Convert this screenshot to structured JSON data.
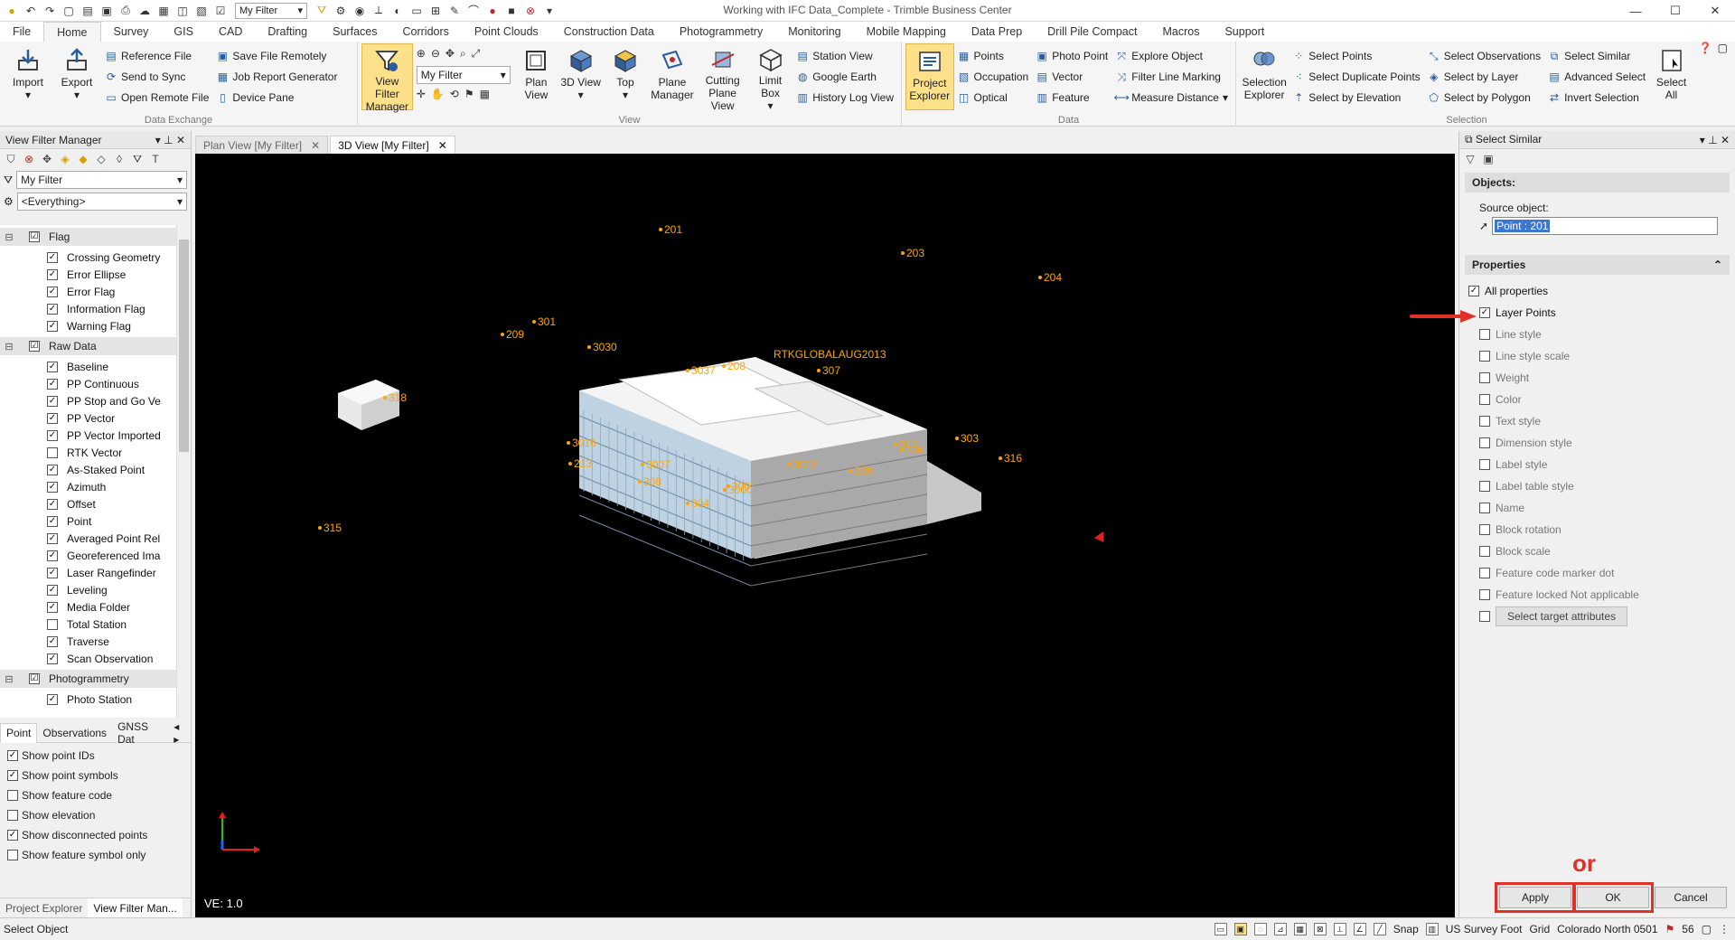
{
  "window": {
    "title": "Working with IFC Data_Complete - Trimble Business Center",
    "filter_value": "My Filter"
  },
  "ribbon_tabs": [
    "File",
    "Home",
    "Survey",
    "GIS",
    "CAD",
    "Drafting",
    "Surfaces",
    "Corridors",
    "Point Clouds",
    "Construction Data",
    "Photogrammetry",
    "Monitoring",
    "Mobile Mapping",
    "Data Prep",
    "Drill Pile Compact",
    "Macros",
    "Support"
  ],
  "ribbon": {
    "data_exchange": {
      "caption": "Data Exchange",
      "import": "Import",
      "export": "Export",
      "reference_file": "Reference File",
      "send_to_sync": "Send to Sync",
      "open_remote_file": "Open Remote File",
      "save_file_remotely": "Save File Remotely",
      "job_report_generator": "Job Report Generator",
      "device_pane": "Device Pane"
    },
    "view": {
      "caption": "View",
      "view_filter_manager": "View Filter Manager",
      "filter_select": "My Filter",
      "plan_view": "Plan View",
      "view_3d": "3D View",
      "top": "Top",
      "plane_manager": "Plane Manager",
      "cutting_plane_view": "Cutting Plane View",
      "limit_box": "Limit Box",
      "station_view": "Station View",
      "google_earth": "Google Earth",
      "history_log_view": "History Log View"
    },
    "data": {
      "caption": "Data",
      "project_explorer": "Project Explorer",
      "points": "Points",
      "occupation": "Occupation",
      "optical": "Optical",
      "photo_point": "Photo Point",
      "vector": "Vector",
      "feature": "Feature",
      "explore_object": "Explore Object",
      "filter_line_marking": "Filter Line Marking",
      "measure_distance": "Measure Distance"
    },
    "selection": {
      "caption": "Selection",
      "selection_explorer": "Selection Explorer",
      "select_points": "Select Points",
      "select_duplicate_points": "Select Duplicate Points",
      "select_by_elevation": "Select by Elevation",
      "select_observations": "Select Observations",
      "select_by_layer": "Select by Layer",
      "select_by_polygon": "Select by Polygon",
      "select_similar": "Select Similar",
      "advanced_select": "Advanced Select",
      "invert_selection": "Invert Selection",
      "select_all": "Select All"
    }
  },
  "left_panel": {
    "title": "View Filter Manager",
    "filter": "My Filter",
    "scope": "<Everything>",
    "groups": [
      {
        "name": "Flag",
        "items": [
          {
            "label": "Crossing Geometry",
            "checked": true
          },
          {
            "label": "Error Ellipse",
            "checked": true
          },
          {
            "label": "Error Flag",
            "checked": true
          },
          {
            "label": "Information Flag",
            "checked": true
          },
          {
            "label": "Warning Flag",
            "checked": true
          }
        ]
      },
      {
        "name": "Raw Data",
        "items": [
          {
            "label": "Baseline",
            "checked": true
          },
          {
            "label": "PP Continuous",
            "checked": true
          },
          {
            "label": "PP Stop and Go Ve",
            "checked": true
          },
          {
            "label": "PP Vector",
            "checked": true
          },
          {
            "label": "PP Vector Imported",
            "checked": true
          },
          {
            "label": "RTK Vector",
            "checked": false
          },
          {
            "label": "As-Staked Point",
            "checked": true
          },
          {
            "label": "Azimuth",
            "checked": true
          },
          {
            "label": "Offset",
            "checked": true
          },
          {
            "label": "Point",
            "checked": true
          },
          {
            "label": "Averaged Point Rel",
            "checked": true
          },
          {
            "label": "Georeferenced Ima",
            "checked": true
          },
          {
            "label": "Laser Rangefinder",
            "checked": true
          },
          {
            "label": "Leveling",
            "checked": true
          },
          {
            "label": "Media Folder",
            "checked": true
          },
          {
            "label": "Total Station",
            "checked": false
          },
          {
            "label": "Traverse",
            "checked": true
          },
          {
            "label": "Scan Observation",
            "checked": true
          }
        ]
      },
      {
        "name": "Photogrammetry",
        "items": [
          {
            "label": "Photo Station",
            "checked": true
          }
        ]
      }
    ],
    "tabs": [
      "Point",
      "Observations",
      "GNSS Dat"
    ],
    "options": [
      {
        "label": "Show point IDs",
        "checked": true
      },
      {
        "label": "Show point symbols",
        "checked": true
      },
      {
        "label": "Show feature code",
        "checked": false
      },
      {
        "label": "Show elevation",
        "checked": false
      },
      {
        "label": "Show disconnected points",
        "checked": true
      },
      {
        "label": "Show feature symbol only",
        "checked": false
      }
    ],
    "bottom_tabs": [
      "Project Explorer",
      "View Filter Man..."
    ]
  },
  "doc_tabs": [
    "Plan View [My Filter]",
    "3D View [My Filter]"
  ],
  "viewport": {
    "ve_label": "VE: 1.0",
    "point_labels": [
      {
        "id": "201"
      },
      {
        "id": "203"
      },
      {
        "id": "204"
      },
      {
        "id": "318"
      },
      {
        "id": "315"
      },
      {
        "id": "303"
      },
      {
        "id": "316"
      },
      {
        "id": "309"
      },
      {
        "id": "213"
      },
      {
        "id": "308"
      },
      {
        "id": "304"
      },
      {
        "id": "3016"
      },
      {
        "id": "3007"
      },
      {
        "id": "3001"
      },
      {
        "id": "3000"
      },
      {
        "id": "3012"
      },
      {
        "id": "310"
      },
      {
        "id": "209"
      },
      {
        "id": "301"
      },
      {
        "id": "3030"
      },
      {
        "id": "208"
      },
      {
        "id": "3037"
      },
      {
        "id": "307"
      },
      {
        "id": "206"
      }
    ],
    "annotation": "RTKGLOBALAUG2013",
    "colors": {
      "point": "#ffa500",
      "background": "#000000"
    }
  },
  "right_panel": {
    "title": "Select Similar",
    "objects_header": "Objects:",
    "source_label": "Source object:",
    "source_value": "Point : 201",
    "properties_header": "Properties",
    "all_properties": "All properties",
    "properties": [
      {
        "label": "Layer Points",
        "checked": true
      },
      {
        "label": "Line style",
        "checked": false
      },
      {
        "label": "Line style scale",
        "checked": false
      },
      {
        "label": "Weight",
        "checked": false
      },
      {
        "label": "Color",
        "checked": false
      },
      {
        "label": "Text style",
        "checked": false
      },
      {
        "label": "Dimension style",
        "checked": false
      },
      {
        "label": "Label style",
        "checked": false
      },
      {
        "label": "Label table style",
        "checked": false
      },
      {
        "label": "Name",
        "checked": false
      },
      {
        "label": "Block rotation",
        "checked": false
      },
      {
        "label": "Block scale",
        "checked": false
      },
      {
        "label": "Feature code marker dot",
        "checked": false
      },
      {
        "label": "Feature locked Not applicable",
        "checked": false
      }
    ],
    "select_target": "Select target attributes",
    "apply": "Apply",
    "ok": "OK",
    "cancel": "Cancel",
    "or_annotation": "or",
    "highlight_color": "#e0302a"
  },
  "status_bar": {
    "left": "Select Object",
    "snap": "Snap",
    "units": "US Survey Foot",
    "grid": "Grid",
    "zone": "Colorado North 0501",
    "count": "56"
  }
}
